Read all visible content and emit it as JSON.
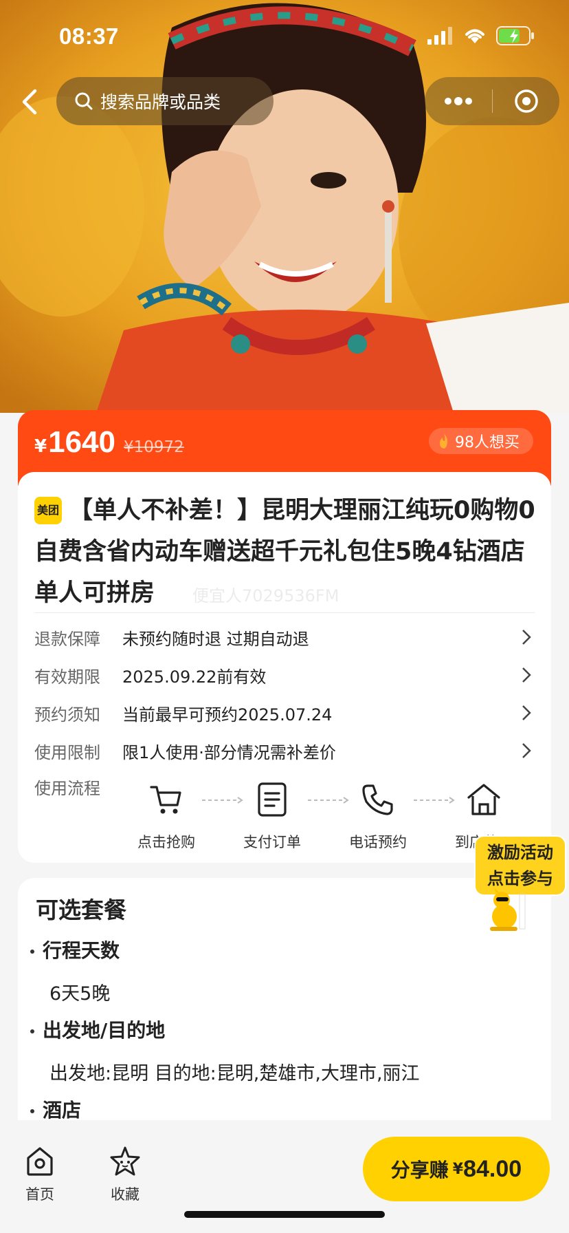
{
  "status_bar": {
    "time": "08:37"
  },
  "nav": {
    "search_placeholder": "搜索品牌或品类"
  },
  "price": {
    "currency": "¥",
    "current": "1640",
    "original": "¥10972",
    "want_count": "98人想买"
  },
  "product": {
    "badge": "美团",
    "title": "【单人不补差！】昆明大理丽江纯玩0购物0自费含省内动车赠送超千元礼包住5晚4钻酒店单人可拼房",
    "watermark": "便宜人7029536FM"
  },
  "info_rows": [
    {
      "label": "退款保障",
      "value": "未预约随时退 过期自动退"
    },
    {
      "label": "有效期限",
      "value": "2025.09.22前有效"
    },
    {
      "label": "预约须知",
      "value": "当前最早可预约2025.07.24"
    },
    {
      "label": "使用限制",
      "value": "限1人使用·部分情况需补差价"
    }
  ],
  "flow": {
    "label": "使用流程",
    "steps": [
      "点击抢购",
      "支付订单",
      "电话预约",
      "到店使用"
    ]
  },
  "packages": {
    "title": "可选套餐",
    "sections": [
      {
        "heading": "行程天数",
        "value": "6天5晚"
      },
      {
        "heading": "出发地/目的地",
        "value": "出发地:昆明 目的地:昆明,楚雄市,大理市,丽江"
      },
      {
        "heading": "酒店",
        "value": ""
      }
    ]
  },
  "promo": {
    "line1": "激励活动",
    "line2": "点击参与"
  },
  "bottom_bar": {
    "home": "首页",
    "favorite": "收藏",
    "share_label": "分享赚",
    "share_currency": "¥",
    "share_amount": "84.00"
  },
  "colors": {
    "accent": "#ff4a14",
    "brand_yellow": "#ffd100"
  }
}
